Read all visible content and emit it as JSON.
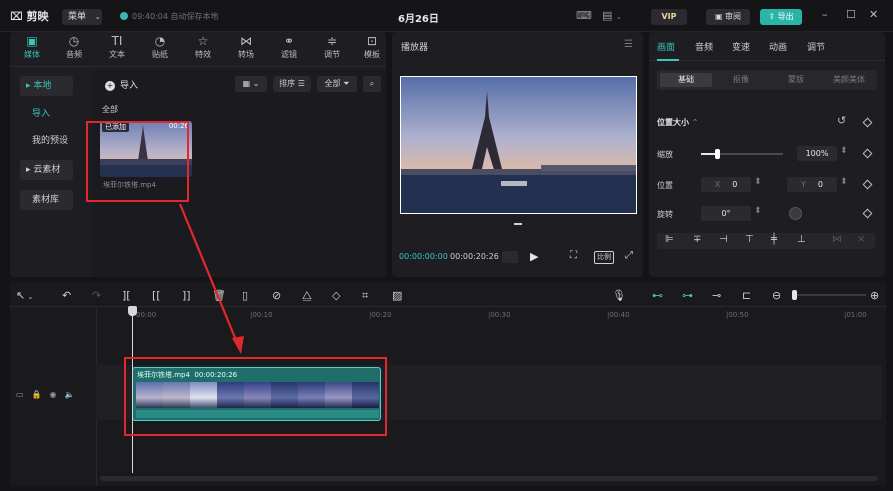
{
  "app": {
    "logo": "剪映",
    "menu_label": "菜单",
    "autosave_text": "09:40:04 自动保存本地",
    "project_title": "6月26日"
  },
  "titlebar": {
    "vip": "VIP",
    "review": "审阅",
    "export": "导出"
  },
  "media_tabs": [
    {
      "label": "媒体",
      "icon": "▣"
    },
    {
      "label": "音频",
      "icon": "◷"
    },
    {
      "label": "文本",
      "icon": "TI"
    },
    {
      "label": "贴纸",
      "icon": "◔"
    },
    {
      "label": "特效",
      "icon": "☆"
    },
    {
      "label": "转场",
      "icon": "⋈"
    },
    {
      "label": "滤镜",
      "icon": "⚭"
    },
    {
      "label": "调节",
      "icon": "≑"
    },
    {
      "label": "模板",
      "icon": "⊡"
    }
  ],
  "media_side": {
    "local": "▸ 本地",
    "import": "导入",
    "presets": "我的预设",
    "cloud": "▸ 云素材",
    "library": "素材库"
  },
  "media_main": {
    "import_btn": "导入",
    "sort": "排序",
    "filter_all": "全部",
    "section_all": "全部",
    "item": {
      "badge": "已添加",
      "duration": "00:26",
      "filename": "埃菲尔铁塔.mp4"
    }
  },
  "player": {
    "title": "播放器",
    "current_time": "00:00:00:00",
    "total_time": "00:00:20:26",
    "ratio": "比例"
  },
  "props": {
    "tabs": [
      "画面",
      "音频",
      "变速",
      "动画",
      "调节"
    ],
    "subtabs": [
      "基础",
      "抠像",
      "蒙版",
      "美颜美体"
    ],
    "section": "位置大小",
    "scale_label": "缩放",
    "scale_value": "100%",
    "position_label": "位置",
    "x_key": "X",
    "x_value": "0",
    "y_key": "Y",
    "y_value": "0",
    "rotate_label": "旋转",
    "rotate_value": "0°"
  },
  "timeline": {
    "ruler": [
      "00:00",
      "|00:10",
      "|00:20",
      "|00:30",
      "|00:40",
      "|00:50",
      "|01:00"
    ],
    "clip_name": "埃菲尔铁塔.mp4",
    "clip_duration": "00:00:20:26",
    "cover_label": "封面"
  }
}
